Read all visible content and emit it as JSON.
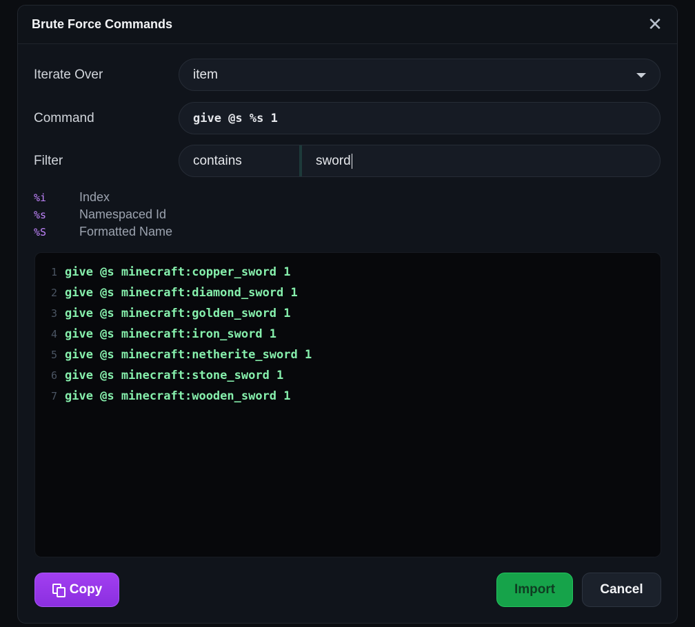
{
  "dialog": {
    "title": "Brute Force Commands",
    "close_icon": "close-icon"
  },
  "form": {
    "iterate_over": {
      "label": "Iterate Over",
      "value": "item"
    },
    "command": {
      "label": "Command",
      "value": "give @s %s 1"
    },
    "filter": {
      "label": "Filter",
      "type": "contains",
      "value": "sword"
    }
  },
  "legend": [
    {
      "key": "%i",
      "desc": "Index"
    },
    {
      "key": "%s",
      "desc": "Namespaced Id"
    },
    {
      "key": "%S",
      "desc": "Formatted Name"
    }
  ],
  "output": {
    "lines": [
      {
        "no": "1",
        "text": "give @s minecraft:copper_sword 1"
      },
      {
        "no": "2",
        "text": "give @s minecraft:diamond_sword 1"
      },
      {
        "no": "3",
        "text": "give @s minecraft:golden_sword 1"
      },
      {
        "no": "4",
        "text": "give @s minecraft:iron_sword 1"
      },
      {
        "no": "5",
        "text": "give @s minecraft:netherite_sword 1"
      },
      {
        "no": "6",
        "text": "give @s minecraft:stone_sword 1"
      },
      {
        "no": "7",
        "text": "give @s minecraft:wooden_sword 1"
      }
    ]
  },
  "buttons": {
    "copy": "Copy",
    "import": "Import",
    "cancel": "Cancel"
  },
  "colors": {
    "accent_purple": "#9333ea",
    "accent_green": "#16a34a",
    "code_green": "#86efac",
    "legend_key": "#c084fc"
  }
}
